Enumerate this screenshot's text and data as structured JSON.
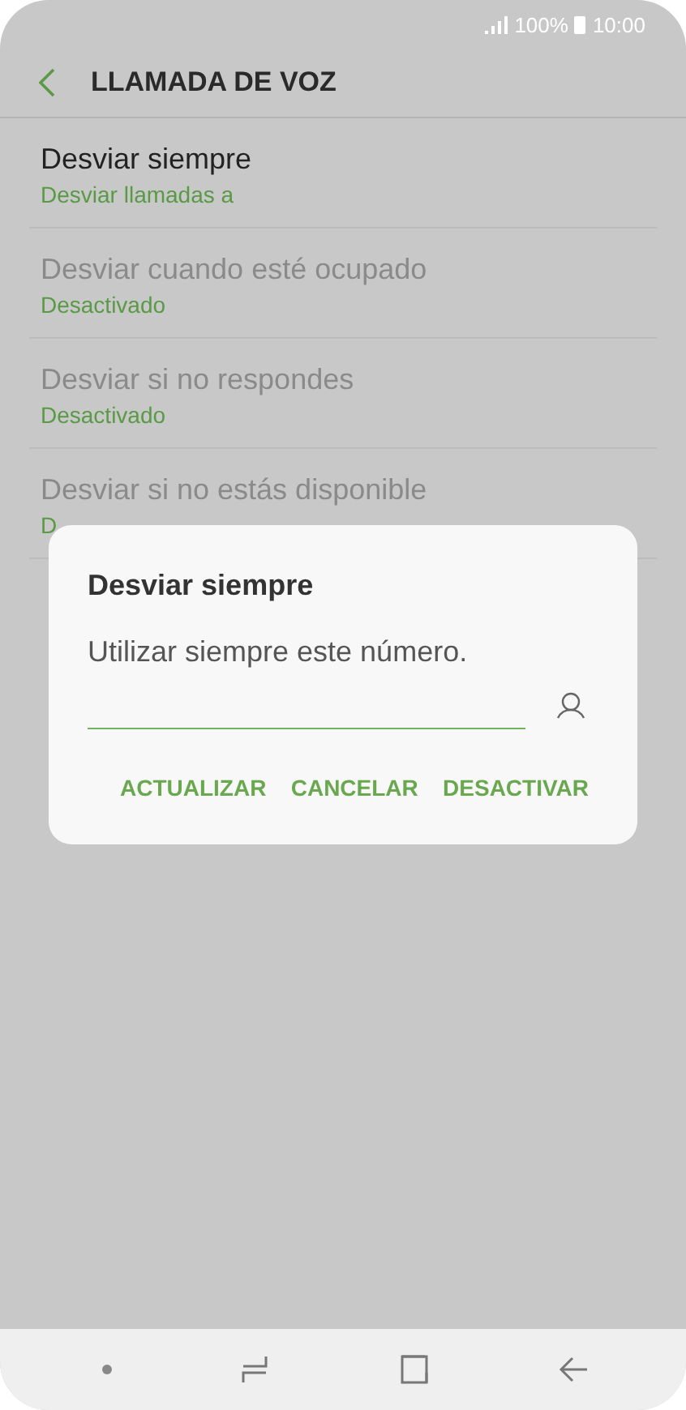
{
  "status_bar": {
    "battery": "100%",
    "time": "10:00"
  },
  "header": {
    "title": "LLAMADA DE VOZ"
  },
  "settings": [
    {
      "title": "Desviar siempre",
      "subtitle": "Desviar llamadas a",
      "disabled": false
    },
    {
      "title": "Desviar cuando esté ocupado",
      "subtitle": "Desactivado",
      "disabled": true
    },
    {
      "title": "Desviar si no respondes",
      "subtitle": "Desactivado",
      "disabled": true
    },
    {
      "title": "Desviar si no estás disponible",
      "subtitle": "D",
      "disabled": true
    }
  ],
  "dialog": {
    "title": "Desviar siempre",
    "message": "Utilizar siempre este número.",
    "buttons": [
      "ACTUALIZAR",
      "CANCELAR",
      "DESACTIVAR"
    ]
  }
}
